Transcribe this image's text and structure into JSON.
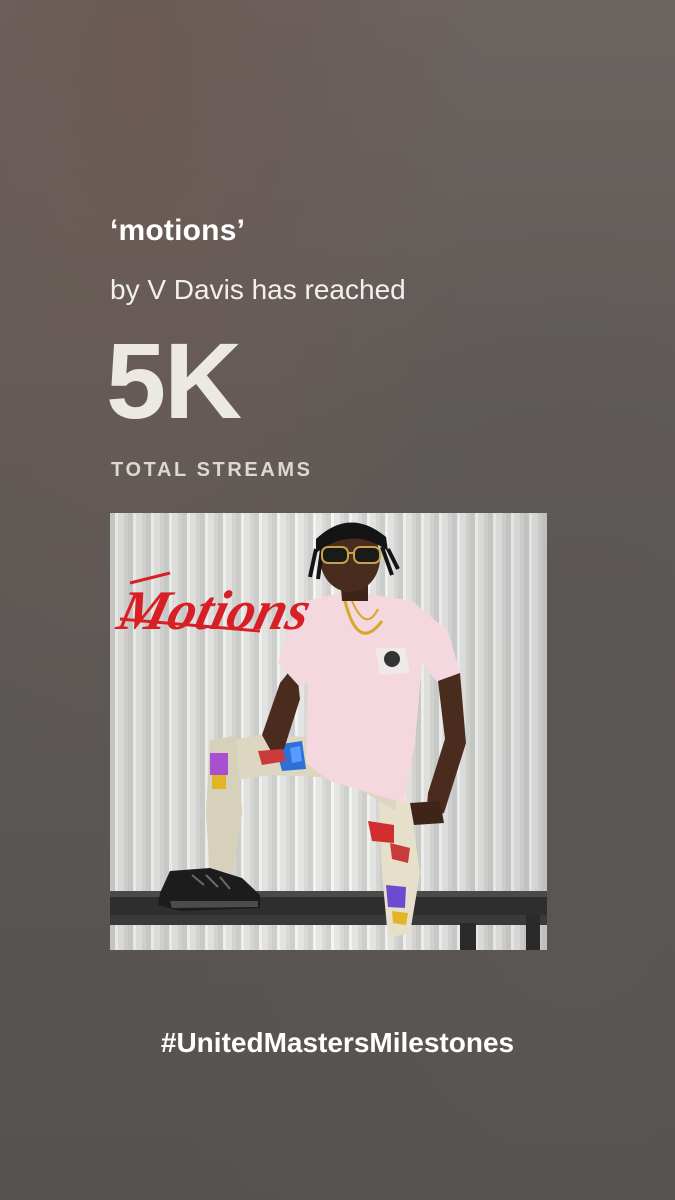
{
  "milestone": {
    "track_title": "‘motions’",
    "subtitle": "by V Davis has reached",
    "count": "5K",
    "count_label": "TOTAL STREAMS"
  },
  "cover_art": {
    "title_text": "Motions",
    "description": "album-cover-art",
    "colors": {
      "title_red": "#d81f26",
      "shirt": "#f4d7df",
      "wall": "#e3e4e2"
    }
  },
  "footer": {
    "hashtag": "#UnitedMastersMilestones"
  }
}
